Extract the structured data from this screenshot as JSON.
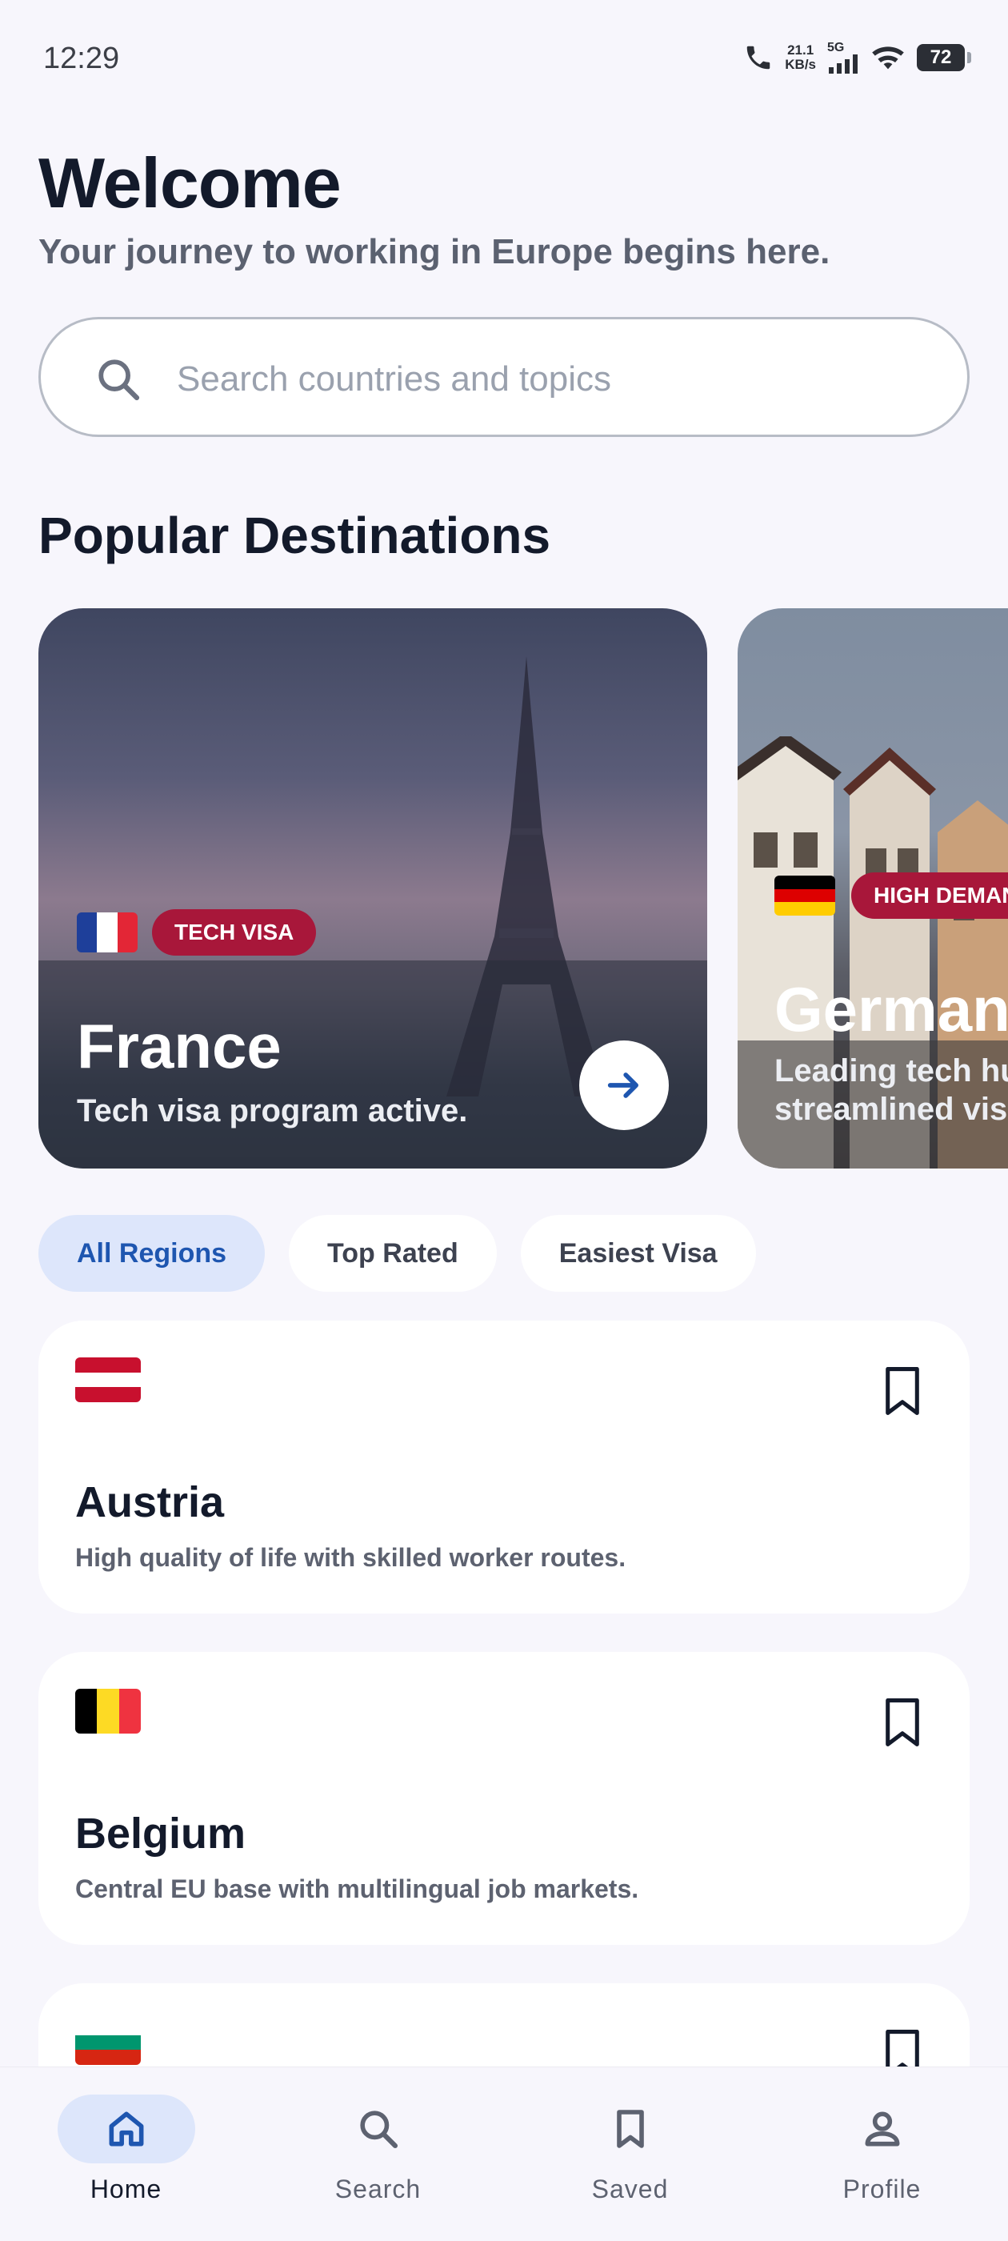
{
  "status_bar": {
    "time": "12:29",
    "speed_value": "21.1",
    "speed_unit": "KB/s",
    "network": "5G",
    "battery": "72"
  },
  "header": {
    "title": "Welcome",
    "subtitle": "Your journey to working in Europe begins here."
  },
  "search": {
    "placeholder": "Search countries and topics",
    "value": ""
  },
  "popular": {
    "title": "Popular Destinations",
    "cards": [
      {
        "country": "France",
        "badge": "TECH VISA",
        "description": "Tech visa program active.",
        "flag_colors": [
          "#1e3f9a",
          "#ffffff",
          "#e32636"
        ]
      },
      {
        "country": "Germany",
        "badge": "HIGH DEMAND",
        "description_line1": "Leading tech hub with",
        "description_line2": "streamlined visa process.",
        "flag_colors": [
          "#000000",
          "#dd0000",
          "#ffcc00"
        ]
      }
    ]
  },
  "filters": {
    "chips": [
      "All Regions",
      "Top Rated",
      "Easiest Visa"
    ],
    "selected": "All Regions"
  },
  "countries": [
    {
      "name": "Austria",
      "description": "High quality of life with skilled worker routes.",
      "flag_colors": [
        "#c8102e",
        "#ffffff",
        "#c8102e"
      ],
      "bookmarked": false
    },
    {
      "name": "Belgium",
      "description": "Central EU base with multilingual job markets.",
      "flag_colors": [
        "#000000",
        "#fdda24",
        "#ef3340"
      ],
      "bookmarked": false
    },
    {
      "name": "",
      "description": "",
      "flag_colors": [
        "#ffffff",
        "#00966e",
        "#d62612"
      ],
      "bookmarked": false
    }
  ],
  "bottom_nav": {
    "items": [
      {
        "label": "Home",
        "icon": "home-icon"
      },
      {
        "label": "Search",
        "icon": "search-icon"
      },
      {
        "label": "Saved",
        "icon": "bookmark-icon"
      },
      {
        "label": "Profile",
        "icon": "profile-icon"
      }
    ],
    "active": "Home"
  },
  "colors": {
    "accent": "#1e56b0",
    "badge": "#a8173a",
    "background": "#f7f6fc"
  }
}
